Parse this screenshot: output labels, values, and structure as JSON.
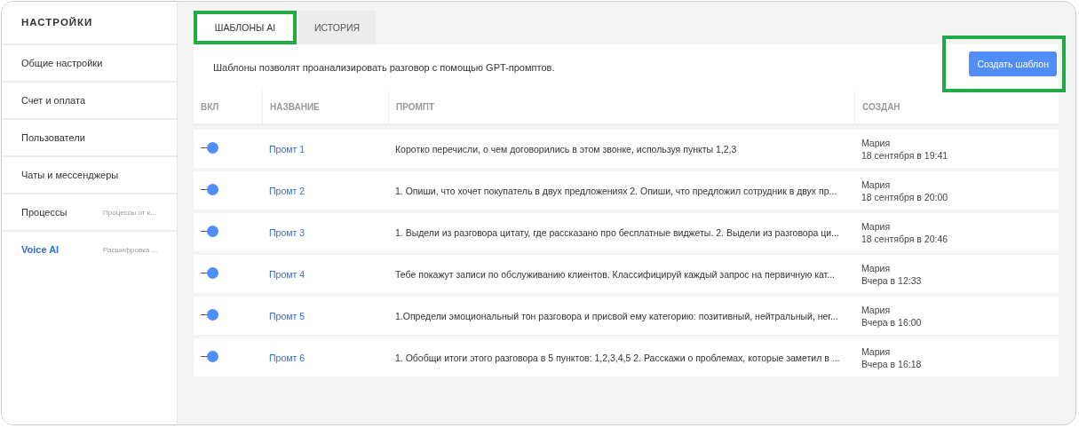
{
  "sidebar": {
    "title": "НАСТРОЙКИ",
    "items": [
      {
        "label": "Общие настройки",
        "selected": false
      },
      {
        "label": "Счет и оплата",
        "selected": false
      },
      {
        "label": "Пользователи",
        "selected": false
      },
      {
        "label": "Чаты и мессенджеры",
        "selected": false
      },
      {
        "label": "Процессы",
        "hint": "Процессы от к...",
        "selected": false
      },
      {
        "label": "Voice AI",
        "hint": "Расшифровка ...",
        "selected": true
      }
    ]
  },
  "tabs": [
    {
      "label": "ШАБЛОНЫ AI",
      "selected": true,
      "highlighted": true
    },
    {
      "label": "ИСТОРИЯ",
      "selected": false,
      "highlighted": false
    }
  ],
  "description": "Шаблоны позволят проанализировать разговор с помощью GPT-промптов.",
  "create_button": {
    "label": "Создать шаблон",
    "highlighted": true
  },
  "table": {
    "columns": [
      "ВКЛ",
      "НАЗВАНИЕ",
      "ПРОМПТ",
      "СОЗДАН"
    ],
    "rows": [
      {
        "on": true,
        "name": "Промт 1",
        "prompt": "Коротко перечисли, о чем договорились в этом звонке, используя пункты 1,2,3",
        "author": "Мария",
        "created": "18 сентября в 19:41"
      },
      {
        "on": true,
        "name": "Промт 2",
        "prompt": "1. Опиши, что хочет покупатель в двух предложениях 2. Опиши, что предложил сотрудник в двух пр...",
        "author": "Мария",
        "created": "18 сентября в 20:00"
      },
      {
        "on": true,
        "name": "Промт 3",
        "prompt": "1. Выдели из разговора цитату, где рассказано про бесплатные виджеты. 2. Выдели из разговора ци...",
        "author": "Мария",
        "created": "18 сентября в 20:46"
      },
      {
        "on": true,
        "name": "Промт 4",
        "prompt": "Тебе покажут записи по обслуживанию клиентов. Классифицируй каждый запрос на первичную кат...",
        "author": "Мария",
        "created": "Вчера в 12:33"
      },
      {
        "on": true,
        "name": "Промт 5",
        "prompt": "1.Определи эмоциональный тон разговора и присвой ему категорию: позитивный, нейтральный, нег...",
        "author": "Мария",
        "created": "Вчера в 16:00"
      },
      {
        "on": true,
        "name": "Промт 6",
        "prompt": "1. Обобщи итоги этого разговора в 5 пунктов: 1,2,3,4,5 2. Расскажи о проблемах, которые заметил в ...",
        "author": "Мария",
        "created": "Вчера в 16:18"
      }
    ]
  }
}
